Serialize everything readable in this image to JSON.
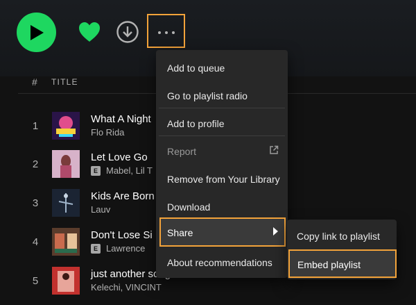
{
  "controls": {
    "play_icon": "play-icon",
    "like_icon": "heart-icon",
    "download_icon": "download-icon",
    "more_icon": "more-options-icon",
    "accent": "#1ed760",
    "highlight": "#f3a33a"
  },
  "table_header": {
    "index": "#",
    "title": "TITLE"
  },
  "tracks": [
    {
      "num": "1",
      "title": "What A Night",
      "artist": "Flo Rida",
      "explicit": false,
      "explicit_label": ""
    },
    {
      "num": "2",
      "title": "Let Love Go",
      "artist": "Mabel, Lil T",
      "explicit": true,
      "explicit_label": "E"
    },
    {
      "num": "3",
      "title": "Kids Are Born",
      "artist": "Lauv",
      "explicit": false,
      "explicit_label": ""
    },
    {
      "num": "4",
      "title": "Don't Lose Si",
      "artist": "Lawrence",
      "explicit": true,
      "explicit_label": "E"
    },
    {
      "num": "5",
      "title": "just another song",
      "artist": "Kelechi, VINCINT",
      "explicit": false,
      "explicit_label": ""
    }
  ],
  "context_menu": {
    "items": [
      {
        "label": "Add to queue"
      },
      {
        "label": "Go to playlist radio"
      },
      {
        "label": "Add to profile"
      },
      {
        "label": "Report"
      },
      {
        "label": "Remove from Your Library"
      },
      {
        "label": "Download"
      },
      {
        "label": "Share"
      },
      {
        "label": "About recommendations"
      }
    ]
  },
  "share_submenu": {
    "items": [
      {
        "label": "Copy link to playlist"
      },
      {
        "label": "Embed playlist"
      }
    ]
  }
}
